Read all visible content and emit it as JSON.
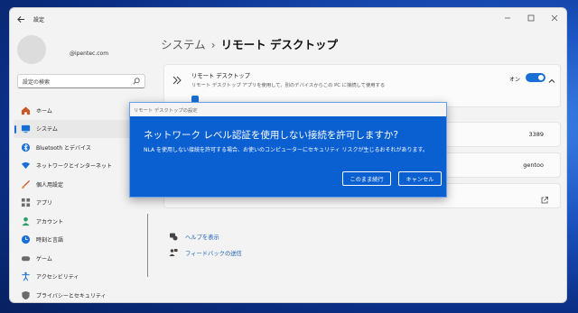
{
  "window": {
    "app_title": "設定",
    "controls": [
      "minimize",
      "maximize",
      "close"
    ]
  },
  "profile": {
    "email": "@ipentec.com"
  },
  "search": {
    "placeholder": "設定の検索"
  },
  "sidebar": {
    "items": [
      {
        "label": "ホーム",
        "icon": "home-icon",
        "color": "#c7582a"
      },
      {
        "label": "システム",
        "icon": "system-icon",
        "color": "#1a6fd6",
        "active": true
      },
      {
        "label": "Bluetooth とデバイス",
        "icon": "bluetooth-icon",
        "color": "#1a6fd6"
      },
      {
        "label": "ネットワークとインターネット",
        "icon": "network-icon",
        "color": "#1a6fd6"
      },
      {
        "label": "個人用設定",
        "icon": "personalization-icon",
        "color": "#c7582a"
      },
      {
        "label": "アプリ",
        "icon": "apps-icon",
        "color": "#6b6b6b"
      },
      {
        "label": "アカウント",
        "icon": "account-icon",
        "color": "#2a9d6a"
      },
      {
        "label": "時刻と言語",
        "icon": "time-language-icon",
        "color": "#1a6fd6"
      },
      {
        "label": "ゲーム",
        "icon": "gaming-icon",
        "color": "#6b6b6b"
      },
      {
        "label": "アクセシビリティ",
        "icon": "accessibility-icon",
        "color": "#1a6fd6"
      },
      {
        "label": "プライバシーとセキュリティ",
        "icon": "shield-icon",
        "color": "#6b6b6b"
      }
    ]
  },
  "breadcrumb": {
    "parent": "システム",
    "separator": "›",
    "current": "リモート デスクトップ"
  },
  "remote_desktop": {
    "title": "リモート デスクトップ",
    "description": "リモート デスクトップ アプリを使用して、別のデバイスからこの PC に接続して使用する",
    "toggle_label": "オン",
    "toggle_on": true
  },
  "port": {
    "value": "3389"
  },
  "pc_name": {
    "value": "gentoo"
  },
  "links": [
    {
      "label": "ヘルプを表示",
      "icon": "help-icon"
    },
    {
      "label": "フィードバックの送信",
      "icon": "feedback-icon"
    }
  ],
  "dialog": {
    "caption": "リモート デスクトップの設定",
    "heading": "ネットワーク レベル認証を使用しない接続を許可しますか?",
    "body": "NLA を使用しない接続を許可する場合、お使いのコンピューターにセキュリティ リスクが生じるおそれがあります。",
    "continue_label": "このまま続行",
    "cancel_label": "キャンセル"
  },
  "colors": {
    "accent": "#1a6fd6",
    "dialog_bg": "#0a5fd1",
    "link": "#1a5fb4"
  }
}
